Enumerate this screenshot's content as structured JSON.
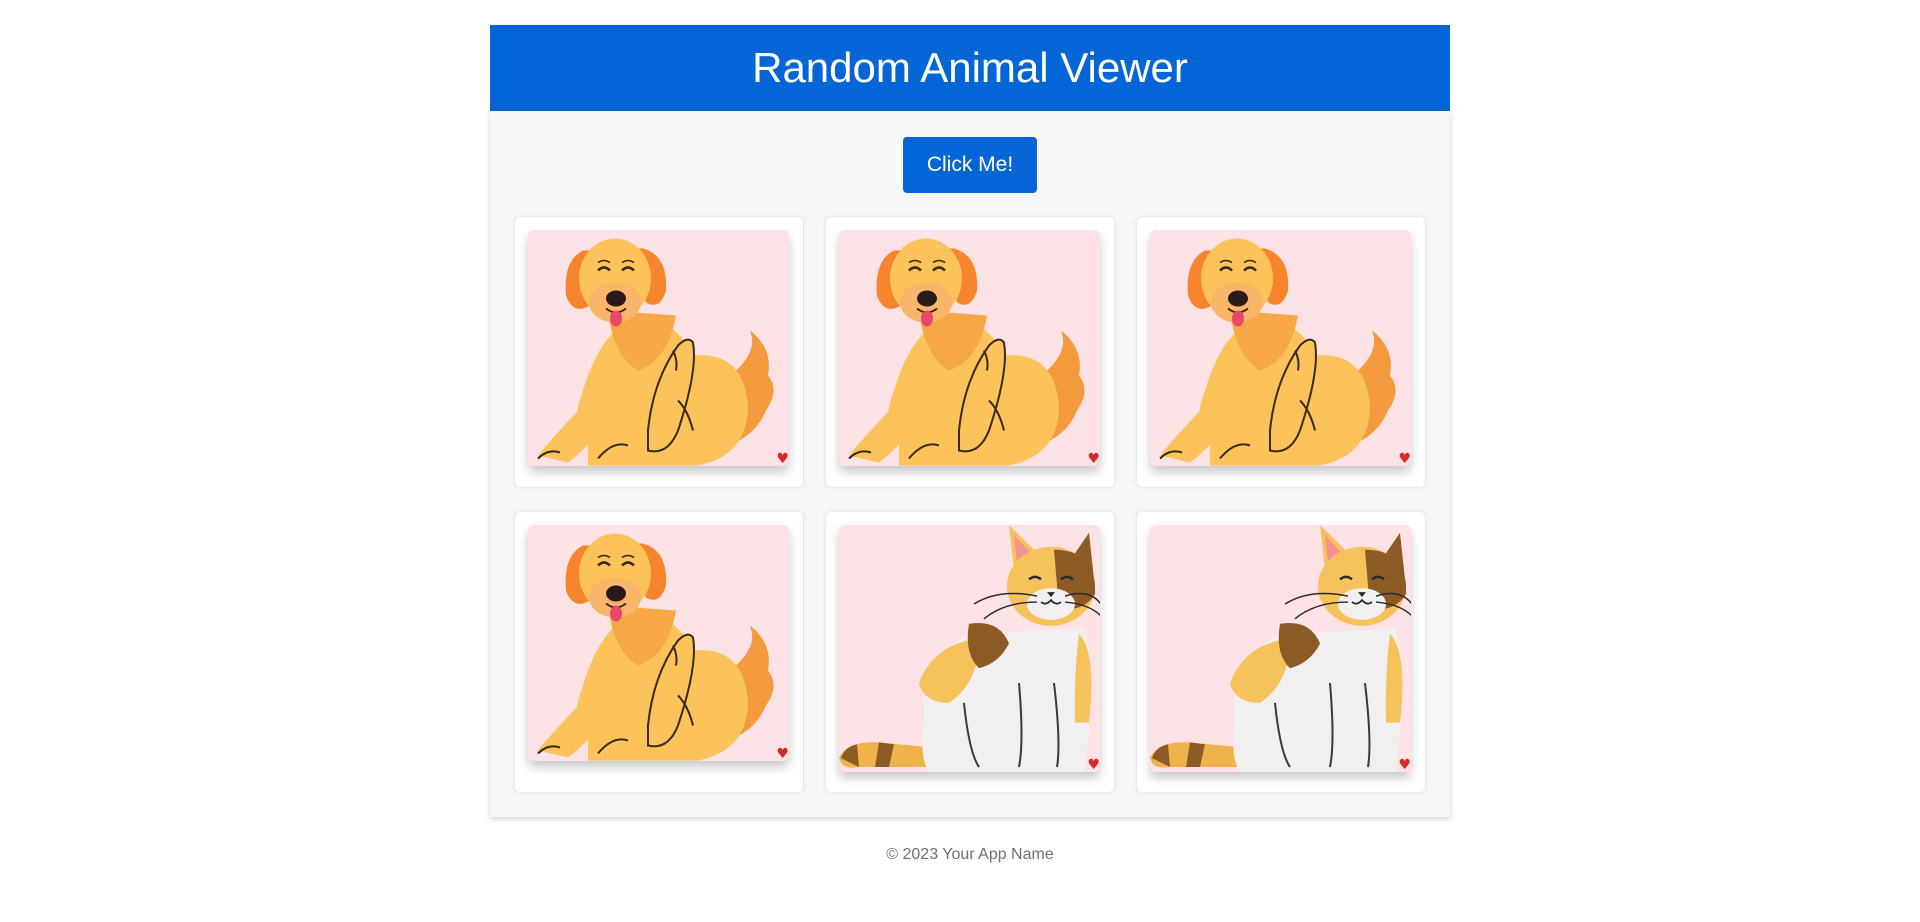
{
  "header": {
    "title": "Random Animal Viewer"
  },
  "action": {
    "button_label": "Click Me!"
  },
  "gallery": {
    "cards": [
      {
        "animal": "dog",
        "icon": "heart-icon"
      },
      {
        "animal": "dog",
        "icon": "heart-icon"
      },
      {
        "animal": "dog",
        "icon": "heart-icon"
      },
      {
        "animal": "dog",
        "icon": "heart-icon"
      },
      {
        "animal": "cat",
        "icon": "heart-icon"
      },
      {
        "animal": "cat",
        "icon": "heart-icon"
      }
    ]
  },
  "footer": {
    "text": "© 2023 Your App Name"
  },
  "colors": {
    "primary": "#0466d6",
    "card_background": "#fde2e5",
    "heart": "#d42a2a"
  }
}
